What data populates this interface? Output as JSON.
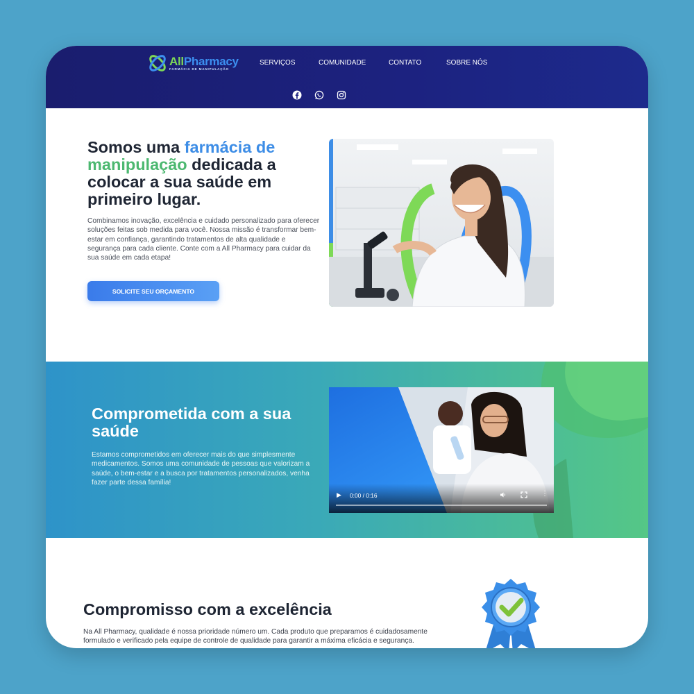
{
  "brand": {
    "name_part1": "All",
    "name_part2": "Pharmacy",
    "tagline": "FARMÁCIA DE MANIPULAÇÃO"
  },
  "nav": {
    "items": [
      {
        "label": "SERVIÇOS"
      },
      {
        "label": "COMUNIDADE"
      },
      {
        "label": "CONTATO"
      },
      {
        "label": "SOBRE NÓS"
      }
    ]
  },
  "socials": [
    "facebook-icon",
    "whatsapp-icon",
    "instagram-icon"
  ],
  "hero": {
    "title_1": "Somos uma ",
    "title_highlight_1": "farmácia de",
    "title_highlight_2": "manipulação",
    "title_2": " dedicada a colocar a sua saúde em primeiro lugar.",
    "description": "Combinamos inovação, excelência e cuidado personalizado para oferecer soluções feitas sob medida para você. Nossa missão é transformar bem-estar em confiança, garantindo tratamentos de alta qualidade e segurança para cada cliente. Conte com a All Pharmacy para cuidar da sua saúde em cada etapa!",
    "cta_label": "SOLICITE SEU ORÇAMENTO"
  },
  "commitment": {
    "title": "Comprometida com a sua saúde",
    "description": "Estamos comprometidos em oferecer mais do que simplesmente medicamentos. Somos uma comunidade de pessoas que valorizam a saúde, o bem-estar e a busca por tratamentos personalizados, venha fazer parte dessa família!",
    "video_time": "0:00 / 0:16",
    "video_progress": 0
  },
  "excellence": {
    "title": "Compromisso com a excelência",
    "description": "Na All Pharmacy, qualidade é nossa prioridade número um. Cada produto que preparamos é cuidadosamente formulado e verificado pela equipe de controle de qualidade para garantir a máxima eficácia e segurança."
  },
  "colors": {
    "header_bg": "#1c2280",
    "accent_blue": "#3d8de6",
    "accent_green": "#4cb870",
    "band_start": "#2e93c9",
    "band_end": "#55c786",
    "page_bg": "#4da3c9"
  }
}
